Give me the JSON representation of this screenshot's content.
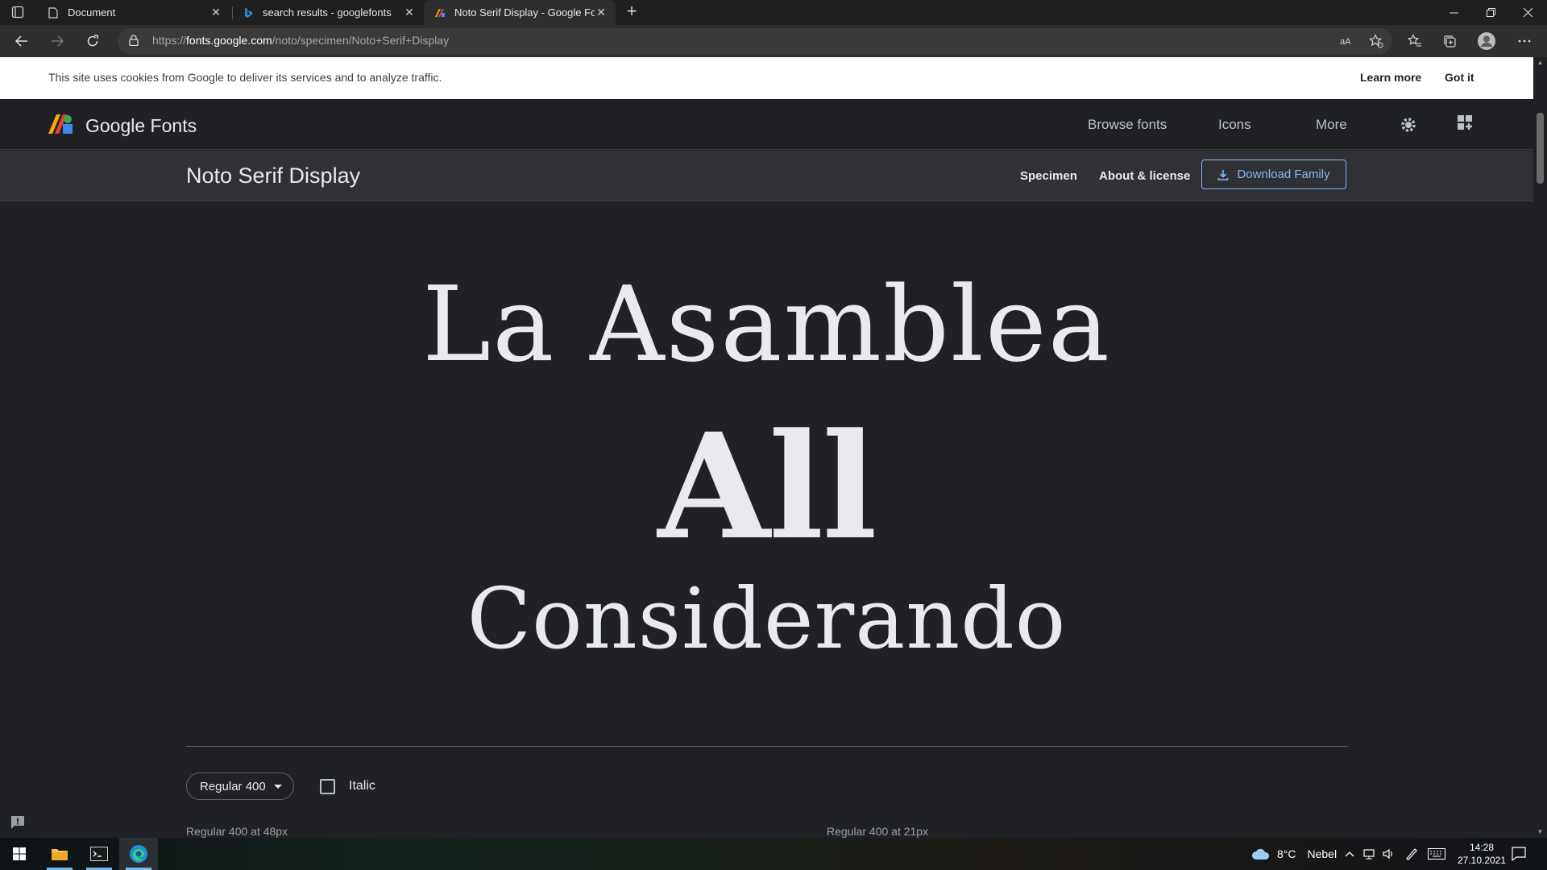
{
  "browser": {
    "tabs": [
      {
        "label": "Document",
        "icon": "document-icon"
      },
      {
        "label": "search results - googlefonts",
        "icon": "bing-icon"
      },
      {
        "label": "Noto Serif Display - Google Font",
        "icon": "google-fonts-favicon"
      }
    ],
    "url_prefix": "https://",
    "url_domain": "fonts.google.com",
    "url_path": "/noto/specimen/Noto+Serif+Display"
  },
  "cookie_banner": {
    "message": "This site uses cookies from Google to deliver its services and to analyze traffic.",
    "learn_more": "Learn more",
    "got_it": "Got it"
  },
  "header": {
    "brand": "Google Fonts",
    "nav": [
      "Browse fonts",
      "Icons",
      "More"
    ]
  },
  "font_bar": {
    "font_name": "Noto Serif Display",
    "specimen_tab": "Specimen",
    "about_tab": "About & license",
    "download_label": "Download Family"
  },
  "specimen": {
    "line1": "La Asamblea",
    "line2": "All",
    "line3": "Considerando"
  },
  "controls": {
    "weight_select": "Regular 400",
    "italic_label": "Italic",
    "italic_checked": false,
    "caption_left": "Regular 400 at 48px",
    "caption_right": "Regular 400 at 21px"
  },
  "taskbar": {
    "weather_temp": "8°C",
    "weather_desc": "Nebel",
    "time": "14:28",
    "date": "27.10.2021"
  },
  "colors": {
    "accent": "#8ab4f8",
    "page_bg": "#202124",
    "font_bar_bg": "#303134"
  }
}
